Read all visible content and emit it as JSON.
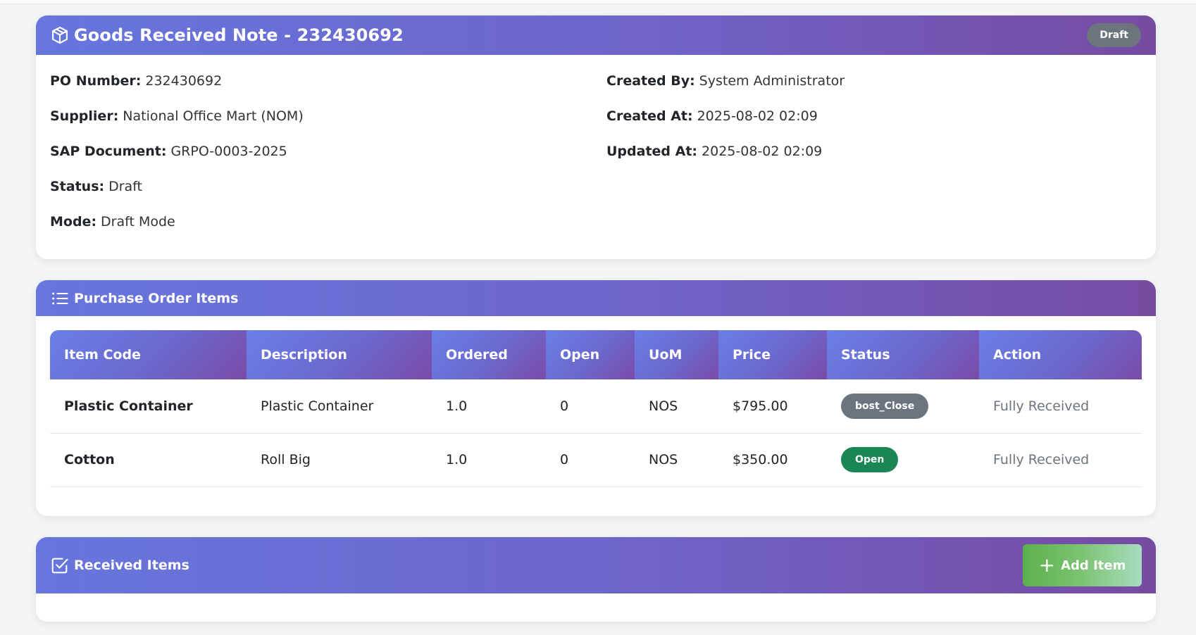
{
  "grn": {
    "title": "Goods Received Note - 232430692",
    "badge": "Draft",
    "left_fields": [
      {
        "label": "PO Number:",
        "value": "232430692"
      },
      {
        "label": "Supplier:",
        "value": "National Office Mart (NOM)"
      },
      {
        "label": "SAP Document:",
        "value": "GRPO-0003-2025"
      },
      {
        "label": "Status:",
        "value": "Draft"
      },
      {
        "label": "Mode:",
        "value": "Draft Mode"
      }
    ],
    "right_fields": [
      {
        "label": "Created By:",
        "value": "System Administrator"
      },
      {
        "label": "Created At:",
        "value": "2025-08-02 02:09"
      },
      {
        "label": "Updated At:",
        "value": "2025-08-02 02:09"
      }
    ]
  },
  "po_items": {
    "title": "Purchase Order Items",
    "columns": [
      "Item Code",
      "Description",
      "Ordered",
      "Open",
      "UoM",
      "Price",
      "Status",
      "Action"
    ],
    "rows": [
      {
        "code": "Plastic Container",
        "description": "Plastic Container",
        "ordered": "1.0",
        "open": "0",
        "uom": "NOS",
        "price": "$795.00",
        "status": "bost_Close",
        "status_color": "#6c757d",
        "action": "Fully Received"
      },
      {
        "code": "Cotton",
        "description": "Roll Big",
        "ordered": "1.0",
        "open": "0",
        "uom": "NOS",
        "price": "$350.00",
        "status": "Open",
        "status_color": "#198754",
        "action": "Fully Received"
      }
    ]
  },
  "received": {
    "title": "Received Items",
    "add_button": "Add Item"
  },
  "icons": {
    "grn": "box-icon",
    "po_items": "list-icon",
    "received": "checkbox-icon",
    "add": "plus-icon"
  }
}
